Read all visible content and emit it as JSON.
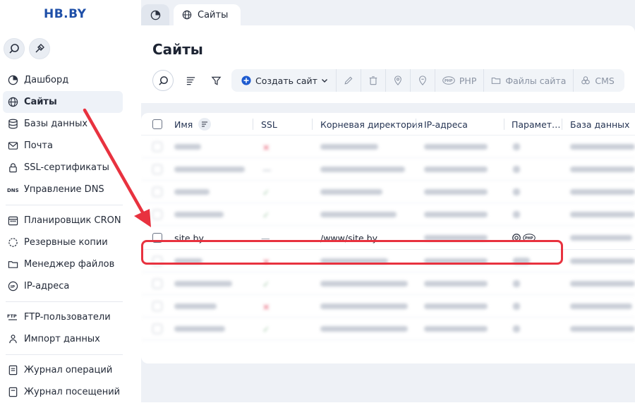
{
  "app": {
    "logo": "HB.BY"
  },
  "sidebar": {
    "items": [
      {
        "label": "Дашборд",
        "icon": "dashboard-icon"
      },
      {
        "label": "Сайты",
        "icon": "globe-icon",
        "active": true
      },
      {
        "label": "Базы данных",
        "icon": "database-icon"
      },
      {
        "label": "Почта",
        "icon": "mail-icon"
      },
      {
        "label": "SSL-сертификаты",
        "icon": "lock-icon"
      },
      {
        "label": "Управление DNS",
        "icon": "dns-icon"
      },
      {
        "label": "Планировщик CRON",
        "icon": "calendar-icon"
      },
      {
        "label": "Резервные копии",
        "icon": "backup-icon"
      },
      {
        "label": "Менеджер файлов",
        "icon": "folder-icon"
      },
      {
        "label": "IP-адреса",
        "icon": "ip-icon"
      },
      {
        "label": "FTP-пользователи",
        "icon": "ftp-icon"
      },
      {
        "label": "Импорт данных",
        "icon": "import-icon"
      },
      {
        "label": "Журнал операций",
        "icon": "log-icon"
      },
      {
        "label": "Журнал посещений",
        "icon": "visits-icon"
      }
    ]
  },
  "tabs": [
    {
      "label": "Сайты",
      "icon": "globe-icon"
    }
  ],
  "main": {
    "title": "Сайты",
    "toolbar": {
      "create_label": "Создать сайт",
      "php_label": "PHP",
      "files_label": "Файлы сайта",
      "cms_label": "CMS"
    }
  },
  "table": {
    "columns": [
      "Имя",
      "SSL",
      "Корневая директория",
      "IP-адреса",
      "Парамет…",
      "База данных"
    ],
    "highlight_row": {
      "name": "site.by",
      "ssl": "—",
      "root": "/www/site.by"
    }
  },
  "colors": {
    "accent": "#1e5bd0",
    "highlight": "#e8323f",
    "brand": "#1e4fa8"
  }
}
